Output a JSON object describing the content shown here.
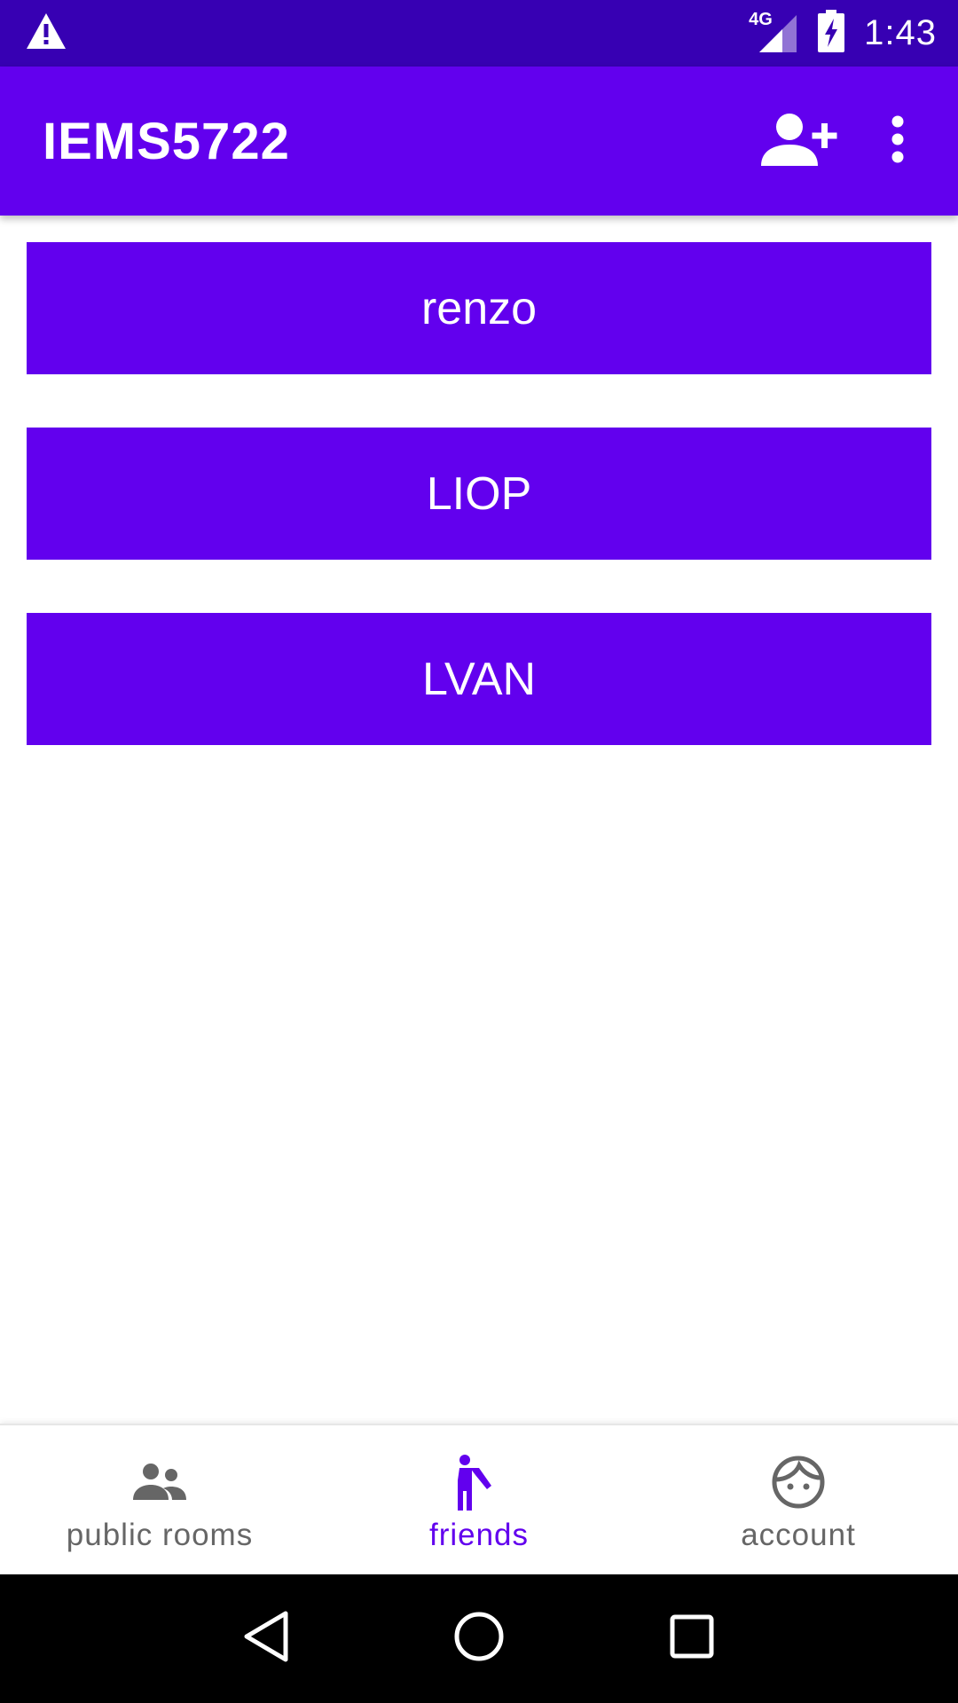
{
  "status_bar": {
    "time": "1:43",
    "network_label": "4G",
    "icons": [
      "warning-icon",
      "signal-icon",
      "battery-charging-icon"
    ]
  },
  "app_bar": {
    "title": "IEMS5722",
    "actions": [
      "add-friend-icon",
      "more-vert-icon"
    ]
  },
  "friends": [
    {
      "name": "renzo"
    },
    {
      "name": "LIOP"
    },
    {
      "name": "LVAN"
    }
  ],
  "bottom_nav": {
    "items": [
      {
        "label": "public rooms",
        "icon": "people-icon",
        "active": false
      },
      {
        "label": "friends",
        "icon": "person-waving-icon",
        "active": true
      },
      {
        "label": "account",
        "icon": "face-icon",
        "active": false
      }
    ]
  },
  "system_nav": {
    "buttons": [
      "back-icon",
      "home-icon",
      "recents-icon"
    ]
  },
  "colors": {
    "primary": "#6200EE",
    "primary_dark": "#3700B3",
    "inactive": "#666666",
    "nav_bar": "#000000"
  }
}
